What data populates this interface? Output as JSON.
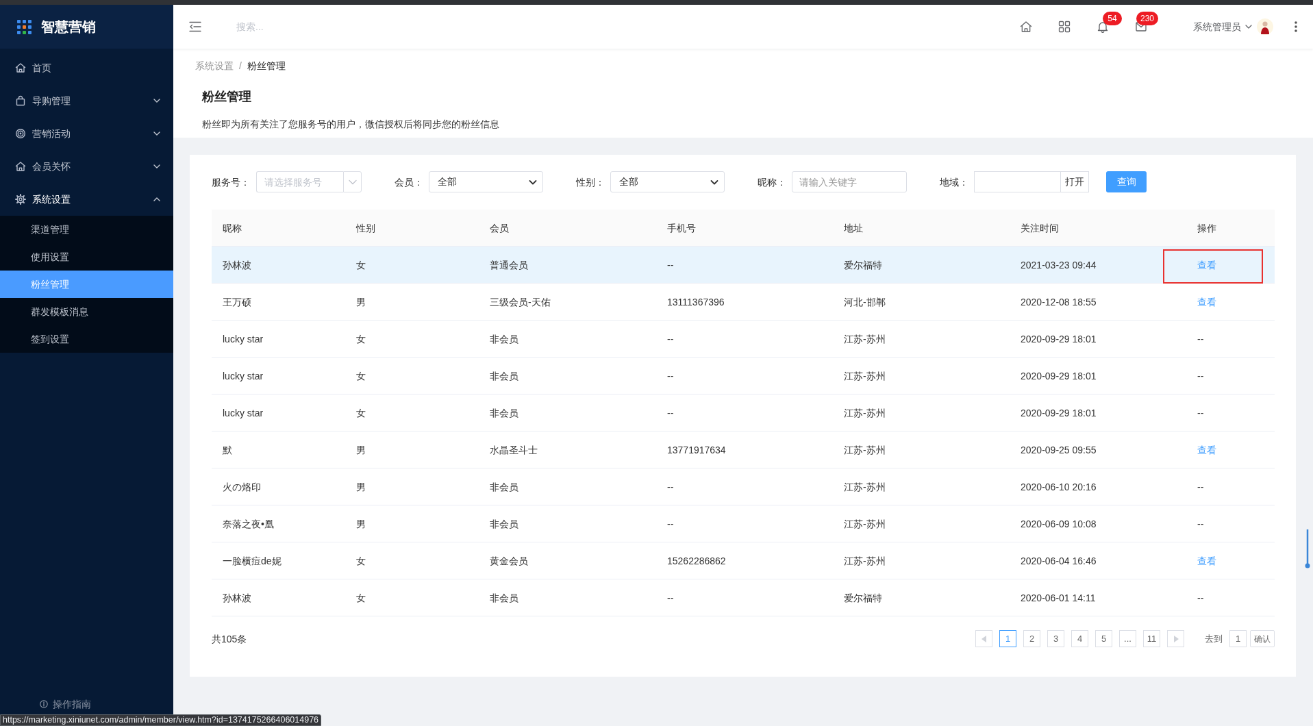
{
  "sidebar": {
    "brand": "智慧营销",
    "items": [
      {
        "label": "首页",
        "kind": "link"
      },
      {
        "label": "导购管理",
        "kind": "group",
        "expanded": false
      },
      {
        "label": "营销活动",
        "kind": "group",
        "expanded": false
      },
      {
        "label": "会员关怀",
        "kind": "group",
        "expanded": false
      },
      {
        "label": "系统设置",
        "kind": "group",
        "expanded": true,
        "children": [
          {
            "label": "渠道管理",
            "selected": false
          },
          {
            "label": "使用设置",
            "selected": false
          },
          {
            "label": "粉丝管理",
            "selected": true
          },
          {
            "label": "群发模板消息",
            "selected": false
          },
          {
            "label": "签到设置",
            "selected": false
          }
        ]
      }
    ],
    "footer_link": "操作指南"
  },
  "header": {
    "search": {
      "placeholder": "搜索..."
    },
    "notifications": {
      "badge": "54"
    },
    "messages": {
      "badge": "230"
    },
    "user": {
      "name": "系统管理员"
    }
  },
  "page_header": {
    "breadcrumb": {
      "items": [
        "系统设置",
        "粉丝管理"
      ],
      "separator": "/"
    },
    "title": "粉丝管理",
    "description": "粉丝即为所有关注了您服务号的用户，微信授权后将同步您的粉丝信息"
  },
  "filters": [
    {
      "label": "服务号：",
      "kind": "combo",
      "placeholder": "请选择服务号"
    },
    {
      "label": "会员：",
      "kind": "select",
      "value": "全部"
    },
    {
      "label": "性别：",
      "kind": "select",
      "value": "全部"
    },
    {
      "label": "昵称：",
      "kind": "input",
      "placeholder": "请输入关键字"
    },
    {
      "label": "地域：",
      "kind": "picker",
      "button": "打开"
    }
  ],
  "search_button": "查询",
  "table": {
    "columns": [
      "昵称",
      "性别",
      "会员",
      "手机号",
      "地址",
      "关注时间",
      "操作"
    ],
    "rows": [
      {
        "selected": true,
        "marked": true,
        "cells": [
          "孙林波",
          "女",
          "普通会员",
          "--",
          "爱尔福特",
          "2021-03-23 09:44"
        ],
        "action": {
          "kind": "link",
          "text": "查看"
        }
      },
      {
        "selected": false,
        "marked": false,
        "cells": [
          "王万硕",
          "男",
          "三级会员-天佑",
          "13111367396",
          "河北-邯郸",
          "2020-12-08 18:55"
        ],
        "action": {
          "kind": "link",
          "text": "查看"
        }
      },
      {
        "selected": false,
        "marked": false,
        "cells": [
          "lucky star",
          "女",
          "非会员",
          "--",
          "江苏-苏州",
          "2020-09-29 18:01"
        ],
        "action": {
          "kind": "text",
          "text": "--"
        }
      },
      {
        "selected": false,
        "marked": false,
        "cells": [
          "lucky star",
          "女",
          "非会员",
          "--",
          "江苏-苏州",
          "2020-09-29 18:01"
        ],
        "action": {
          "kind": "text",
          "text": "--"
        }
      },
      {
        "selected": false,
        "marked": false,
        "cells": [
          "lucky star",
          "女",
          "非会员",
          "--",
          "江苏-苏州",
          "2020-09-29 18:01"
        ],
        "action": {
          "kind": "text",
          "text": "--"
        }
      },
      {
        "selected": false,
        "marked": false,
        "cells": [
          "默",
          "男",
          "水晶圣斗士",
          "13771917634",
          "江苏-苏州",
          "2020-09-25 09:55"
        ],
        "action": {
          "kind": "link",
          "text": "查看"
        }
      },
      {
        "selected": false,
        "marked": false,
        "cells": [
          "火の烙印",
          "男",
          "非会员",
          "--",
          "江苏-苏州",
          "2020-06-10 20:16"
        ],
        "action": {
          "kind": "text",
          "text": "--"
        }
      },
      {
        "selected": false,
        "marked": false,
        "cells": [
          "奈落之夜•凰",
          "男",
          "非会员",
          "--",
          "江苏-苏州",
          "2020-06-09 10:08"
        ],
        "action": {
          "kind": "text",
          "text": "--"
        }
      },
      {
        "selected": false,
        "marked": false,
        "cells": [
          "一脸横痘de妮",
          "女",
          "黄金会员",
          "15262286862",
          "江苏-苏州",
          "2020-06-04 16:46"
        ],
        "action": {
          "kind": "link",
          "text": "查看"
        }
      },
      {
        "selected": false,
        "marked": false,
        "cells": [
          "孙林波",
          "女",
          "非会员",
          "--",
          "爱尔福特",
          "2020-06-01 14:11"
        ],
        "action": {
          "kind": "text",
          "text": "--"
        }
      }
    ]
  },
  "pagination": {
    "total": "共105条",
    "pages": [
      {
        "label": "1",
        "selected": true
      },
      {
        "label": "2",
        "selected": false
      },
      {
        "label": "3",
        "selected": false
      },
      {
        "label": "4",
        "selected": false
      },
      {
        "label": "5",
        "selected": false
      },
      {
        "label": "...",
        "selected": false
      },
      {
        "label": "11",
        "selected": false
      }
    ],
    "goto_label": "去到",
    "goto_value": "1",
    "confirm": "确认"
  },
  "status_bar": {
    "url": "https://marketing.xiniunet.com/admin/member/view.htm?id=1374175266406014976"
  }
}
